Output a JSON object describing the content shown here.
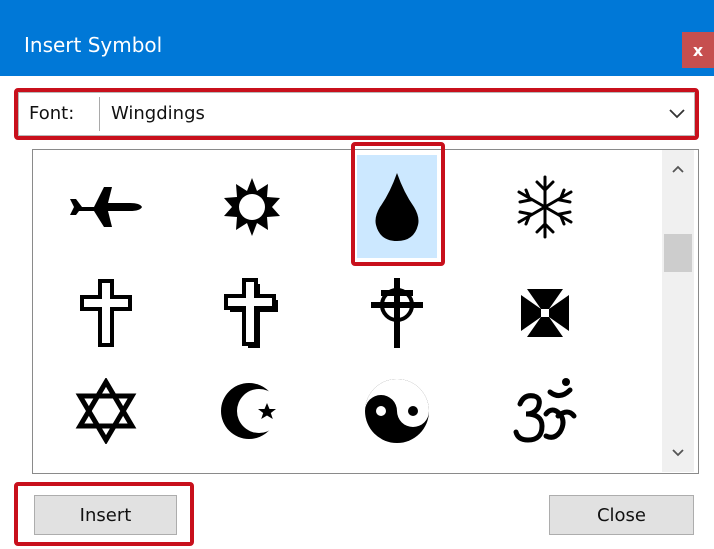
{
  "window": {
    "title": "Insert Symbol",
    "close_glyph": "x",
    "close_color": "#c64f4f",
    "titlebar_color": "#0078d7"
  },
  "font_selector": {
    "label": "Font:",
    "value": "Wingdings"
  },
  "symbols": [
    {
      "name": "airplane-icon"
    },
    {
      "name": "sun-icon"
    },
    {
      "name": "droplet-icon",
      "selected": true
    },
    {
      "name": "snowflake-icon"
    },
    {
      "name": "latin-cross-icon"
    },
    {
      "name": "shadowed-cross-icon"
    },
    {
      "name": "celtic-cross-icon"
    },
    {
      "name": "maltese-cross-icon"
    },
    {
      "name": "star-of-david-icon"
    },
    {
      "name": "star-and-crescent-icon"
    },
    {
      "name": "yin-yang-icon"
    },
    {
      "name": "om-icon"
    }
  ],
  "buttons": {
    "insert_label": "Insert",
    "close_label": "Close"
  },
  "highlight_color": "#c8101c",
  "selection_color": "#cce8ff"
}
